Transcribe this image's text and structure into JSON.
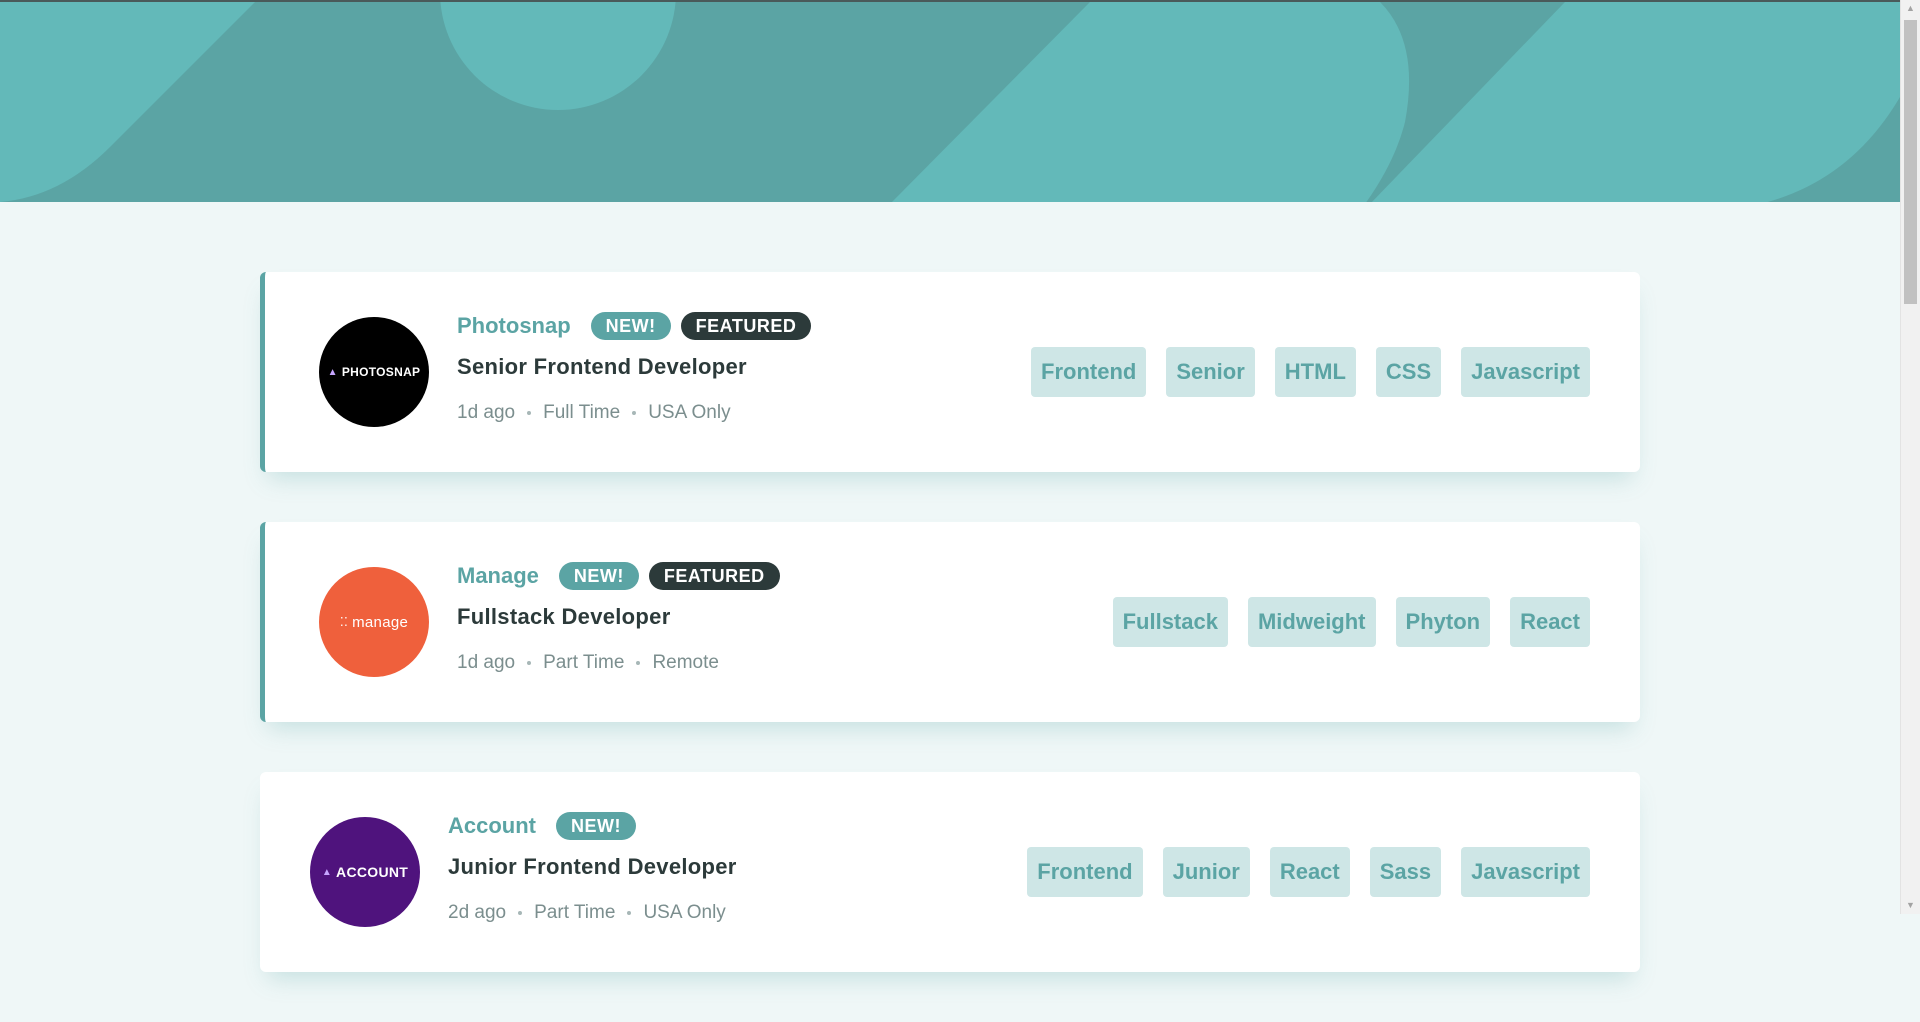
{
  "jobs": [
    {
      "company": "Photosnap",
      "logo_text": "PHOTOSNAP",
      "logo_color": "#000000",
      "is_new": true,
      "is_featured": true,
      "badge_new": "NEW!",
      "badge_featured": "FEATURED",
      "position": "Senior Frontend Developer",
      "posted": "1d ago",
      "contract": "Full Time",
      "location": "USA Only",
      "tags": [
        "Frontend",
        "Senior",
        "HTML",
        "CSS",
        "Javascript"
      ]
    },
    {
      "company": "Manage",
      "logo_text": "manage",
      "logo_color": "#ef603c",
      "is_new": true,
      "is_featured": true,
      "badge_new": "NEW!",
      "badge_featured": "FEATURED",
      "position": "Fullstack Developer",
      "posted": "1d ago",
      "contract": "Part Time",
      "location": "Remote",
      "tags": [
        "Fullstack",
        "Midweight",
        "Phyton",
        "React"
      ]
    },
    {
      "company": "Account",
      "logo_text": "ACCOUNT",
      "logo_color": "#4f137d",
      "is_new": true,
      "is_featured": false,
      "badge_new": "NEW!",
      "position": "Junior Frontend Developer",
      "posted": "2d ago",
      "contract": "Part Time",
      "location": "USA Only",
      "tags": [
        "Frontend",
        "Junior",
        "React",
        "Sass",
        "Javascript"
      ]
    }
  ],
  "theme": {
    "primary": "#5ba4a4",
    "background": "#eff7f7",
    "tag_background": "#cee6e6",
    "dark": "#2c3a3a"
  }
}
